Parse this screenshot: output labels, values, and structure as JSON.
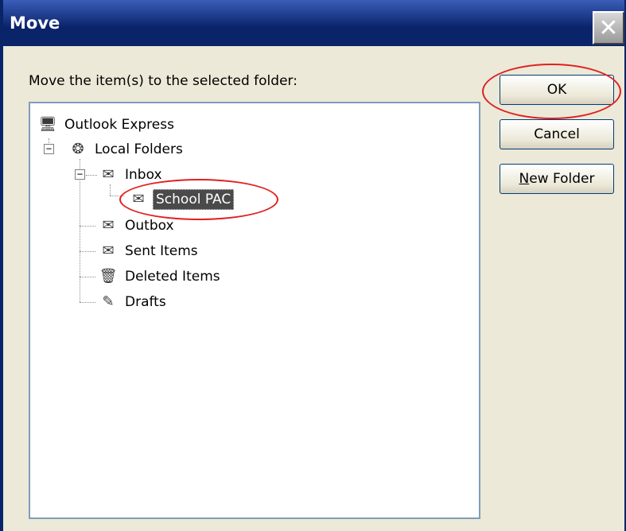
{
  "window": {
    "title": "Move",
    "close_glyph": "✕"
  },
  "prompt": "Move the item(s) to the selected folder:",
  "buttons": {
    "ok": "OK",
    "cancel": "Cancel",
    "new_folder_access_key": "N",
    "new_folder_rest": "ew Folder"
  },
  "tree": {
    "root": {
      "label": "Outlook Express",
      "icon": "outlook-express-icon"
    },
    "local_folders": {
      "label": "Local Folders",
      "icon": "local-folders-icon",
      "expander": "−"
    },
    "inbox": {
      "label": "Inbox",
      "icon": "inbox-icon",
      "expander": "−"
    },
    "school_pac": {
      "label": "School PAC",
      "icon": "folder-icon",
      "selected": true
    },
    "outbox": {
      "label": "Outbox",
      "icon": "outbox-icon"
    },
    "sent_items": {
      "label": "Sent Items",
      "icon": "sent-items-icon"
    },
    "deleted_items": {
      "label": "Deleted Items",
      "icon": "deleted-items-icon"
    },
    "drafts": {
      "label": "Drafts",
      "icon": "drafts-icon"
    }
  },
  "annotation_color": "#e02020"
}
